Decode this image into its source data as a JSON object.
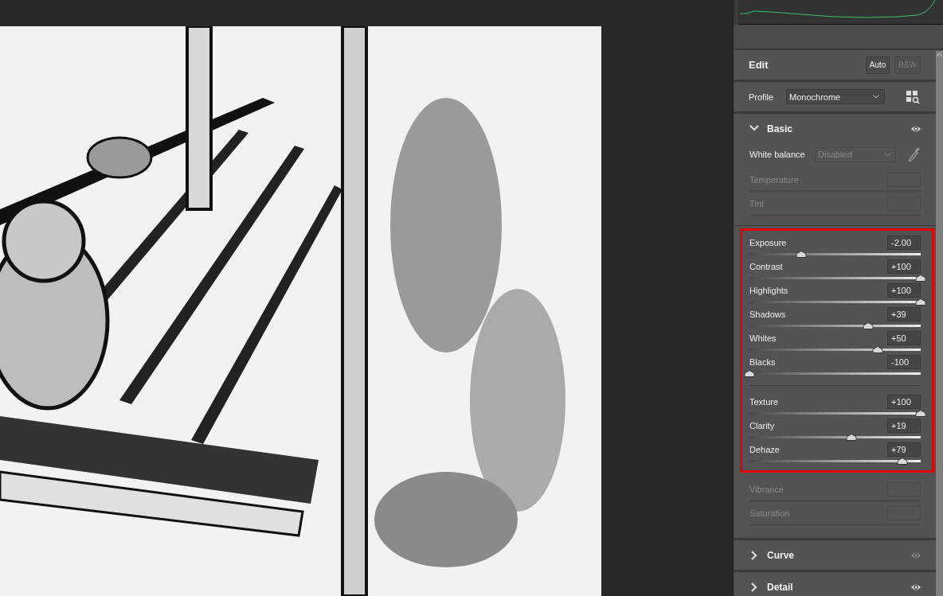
{
  "edit": {
    "title": "Edit",
    "buttons": [
      {
        "label": "Auto",
        "disabled": false
      },
      {
        "label": "B&W",
        "disabled": true
      }
    ]
  },
  "profile": {
    "label": "Profile",
    "value": "Monochrome"
  },
  "sections": [
    {
      "title": "Basic",
      "expanded": true,
      "preview_on": true,
      "white_balance": {
        "label": "White balance",
        "value": "Disabled",
        "disabled": true
      },
      "groups": [
        {
          "highlighted": false,
          "rows": [
            {
              "label": "Temperature",
              "disabled": true
            },
            {
              "label": "Tint",
              "disabled": true
            }
          ]
        },
        {
          "highlighted": true,
          "rows": [
            {
              "label": "Exposure",
              "disabled": false,
              "value": "-2.00",
              "level": 0.3
            },
            {
              "label": "Contrast",
              "disabled": false,
              "value": "+100",
              "level": 1
            },
            {
              "label": "Highlights",
              "disabled": false,
              "value": "+100",
              "level": 1
            },
            {
              "label": "Shadows",
              "disabled": false,
              "value": "+39",
              "level": 0.695
            },
            {
              "label": "Whites",
              "disabled": false,
              "value": "+50",
              "level": 0.75
            },
            {
              "label": "Blacks",
              "disabled": false,
              "value": "-100",
              "level": 0
            }
          ]
        },
        {
          "highlighted": true,
          "rows": [
            {
              "label": "Texture",
              "disabled": false,
              "value": "+100",
              "level": 1
            },
            {
              "label": "Clarity",
              "disabled": false,
              "value": "+19",
              "level": 0.595
            },
            {
              "label": "Dehaze",
              "disabled": false,
              "value": "+79",
              "level": 0.895
            }
          ]
        },
        {
          "highlighted": false,
          "rows": [
            {
              "label": "Vibrance",
              "disabled": true
            },
            {
              "label": "Saturation",
              "disabled": true
            }
          ]
        }
      ]
    },
    {
      "title": "Curve",
      "expanded": false,
      "preview_on": false
    },
    {
      "title": "Detail",
      "expanded": false,
      "preview_on": true
    }
  ]
}
